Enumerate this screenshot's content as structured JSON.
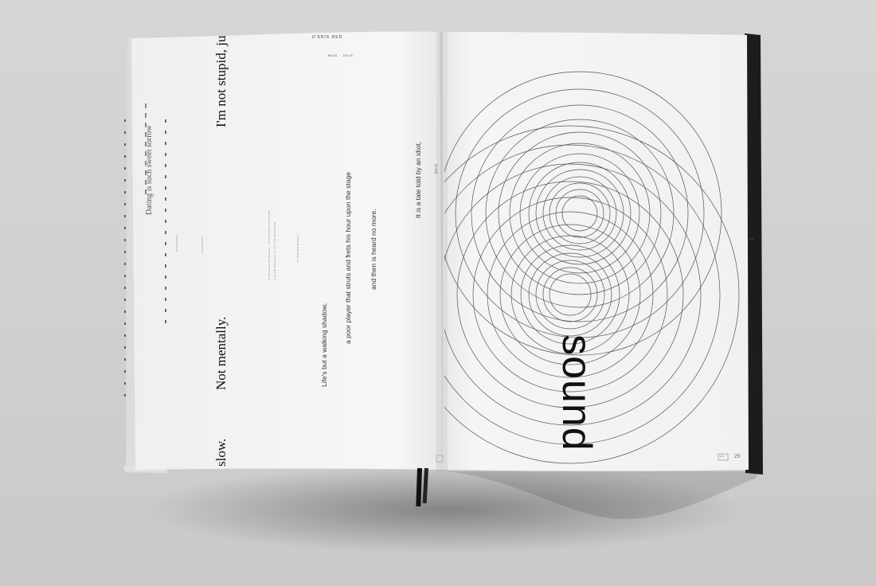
{
  "magazine": {
    "masthead": "D'ERIS RED",
    "issue_line": "MAG · 2015",
    "page_number": "29",
    "page_box_label": "LU"
  },
  "left_page": {
    "headline_top": "I'm not stupid, ju",
    "headline_bottom": "Not mentally.",
    "headline_slow": "slow.",
    "caption_1": "Dating is such sweet sorrow",
    "label_left_a": "STANDARD",
    "label_left_b": "STANDARD",
    "label_mid": "STANDARD STANDARD · STANDARD STANDARD",
    "label_mid_2": "A SLOW GRADUALLY BY THE DISTANCE",
    "label_right": "STANDARD MIDDLE",
    "quote_line_1": "Life's but a walking shadow,",
    "quote_line_2": "a poor player that struts and frets his hour upon the stage",
    "quote_line_3": "and then is heard no more.",
    "quote_line_4": "It is a tale told by an idiot,",
    "quote_line_5": "full of"
  },
  "right_page": {
    "word": "sound"
  },
  "colors": {
    "paper": "#f4f4f2",
    "ink": "#111111",
    "line": "#555555",
    "background": "#d2d2d2"
  }
}
